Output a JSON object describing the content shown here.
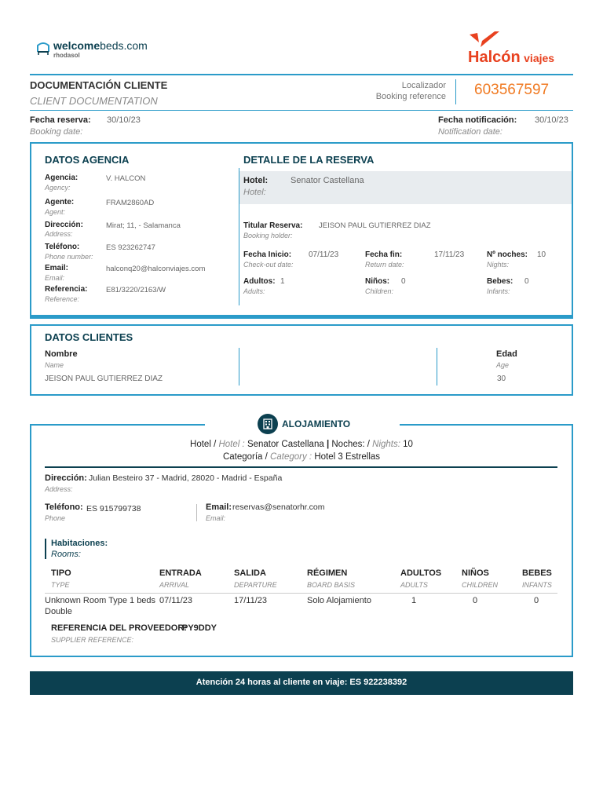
{
  "brand": {
    "welcome_strong": "welcome",
    "welcome_light": "beds.com",
    "welcome_sub": "rhodasol",
    "halcon": "Halcón",
    "viajes": "viajes"
  },
  "doc": {
    "title": "DOCUMENTACIÓN CLIENTE",
    "title_en": "CLIENT DOCUMENTATION",
    "loc_label": "Localizador",
    "loc_label_en": "Booking reference",
    "loc_value": "603567597",
    "booking_date_label": "Fecha reserva:",
    "booking_date_label_en": "Booking date:",
    "booking_date": "30/10/23",
    "notif_label": "Fecha notificación:",
    "notif_label_en": "Notification date:",
    "notif_date": "30/10/23"
  },
  "agency": {
    "title": "DATOS AGENCIA",
    "rows": [
      {
        "label": "Agencia:",
        "sub": "Agency:",
        "value": "V. HALCON"
      },
      {
        "label": "Agente:",
        "sub": "Agent:",
        "value": "FRAM2860AD"
      },
      {
        "label": "Dirección:",
        "sub": "Address:",
        "value": "Mirat; 11, - Salamanca"
      },
      {
        "label": "Teléfono:",
        "sub": "Phone number:",
        "value": "ES 923262747"
      },
      {
        "label": "Email:",
        "sub": "Email:",
        "value": "halconq20@halconviajes.com"
      },
      {
        "label": "Referencia:",
        "sub": "Reference:",
        "value": "E81/3220/2163/W"
      }
    ]
  },
  "booking": {
    "title": "DETALLE DE LA RESERVA",
    "hotel_label": "Hotel:",
    "hotel_label_en": "Hotel:",
    "hotel_value": "Senator Castellana",
    "holder_label": "Titular Reserva:",
    "holder_label_en": "Booking holder:",
    "holder_value": "JEISON PAUL GUTIERREZ DIAZ",
    "start_label": "Fecha Inicio:",
    "start_label_en": "Check-out date:",
    "start_value": "07/11/23",
    "end_label": "Fecha fin:",
    "end_label_en": "Return date:",
    "end_value": "17/11/23",
    "nights_label": "Nº noches:",
    "nights_label_en": "Nights:",
    "nights_value": "10",
    "adults_label": "Adultos:",
    "adults_label_en": "Adults:",
    "adults_value": "1",
    "children_label": "Niños:",
    "children_label_en": "Children:",
    "children_value": "0",
    "babies_label": "Bebes:",
    "babies_label_en": "Infants:",
    "babies_value": "0"
  },
  "clients": {
    "title": "DATOS CLIENTES",
    "name_label": "Nombre",
    "name_label_en": "Name",
    "age_label": "Edad",
    "age_label_en": "Age",
    "name_value": "JEISON PAUL GUTIERREZ DIAZ",
    "age_value": "30"
  },
  "accommodation": {
    "title": "ALOJAMIENTO",
    "hotel_label": "Hotel /",
    "hotel_label_en": "Hotel :",
    "hotel_value": "Senator Castellana",
    "sep": "|",
    "nights_label": "Noches: /",
    "nights_label_en": "Nights:",
    "nights_value": "10",
    "category_label": "Categoría /",
    "category_label_en": "Category :",
    "category_value": "Hotel 3 Estrellas",
    "address_label": "Dirección:",
    "address_label_en": "Address:",
    "address_value": "Julian Besteiro 37 - Madrid, 28020 - Madrid - España",
    "phone_label": "Teléfono:",
    "phone_label_en": "Phone",
    "phone_value": "ES 915799738",
    "email_label": "Email:",
    "email_label_en": "Email:",
    "email_value": "reservas@senatorhr.com",
    "rooms_label": "Habitaciones:",
    "rooms_label_en": "Rooms:",
    "columns": [
      {
        "label": "TIPO",
        "sub": "TYPE"
      },
      {
        "label": "ENTRADA",
        "sub": "ARRIVAL"
      },
      {
        "label": "SALIDA",
        "sub": "DEPARTURE"
      },
      {
        "label": "RÉGIMEN",
        "sub": "BOARD BASIS"
      },
      {
        "label": "ADULTOS",
        "sub": "ADULTS"
      },
      {
        "label": "NIÑOS",
        "sub": "CHILDREN"
      },
      {
        "label": "BEBES",
        "sub": "INFANTS"
      }
    ],
    "room": {
      "type_line1": "Unknown Room Type 1 beds",
      "type_line2": "Double",
      "arrival": "07/11/23",
      "departure": "17/11/23",
      "board": "Solo Alojamiento",
      "adults": "1",
      "children": "0",
      "infants": "0"
    },
    "supplier_label": "REFERENCIA DEL PROVEEDOR:",
    "supplier_label_en": "SUPPLIER REFERENCE:",
    "supplier_value": "PY9DDY"
  },
  "footer": {
    "text": "Atención 24 horas al cliente en viaje:",
    "phone": "ES 922238392"
  },
  "colors": {
    "teal_dark": "#0c4050",
    "accent_blue": "#2b9bc9",
    "halcon_red": "#e8411f",
    "loc_orange": "#f07a22"
  }
}
